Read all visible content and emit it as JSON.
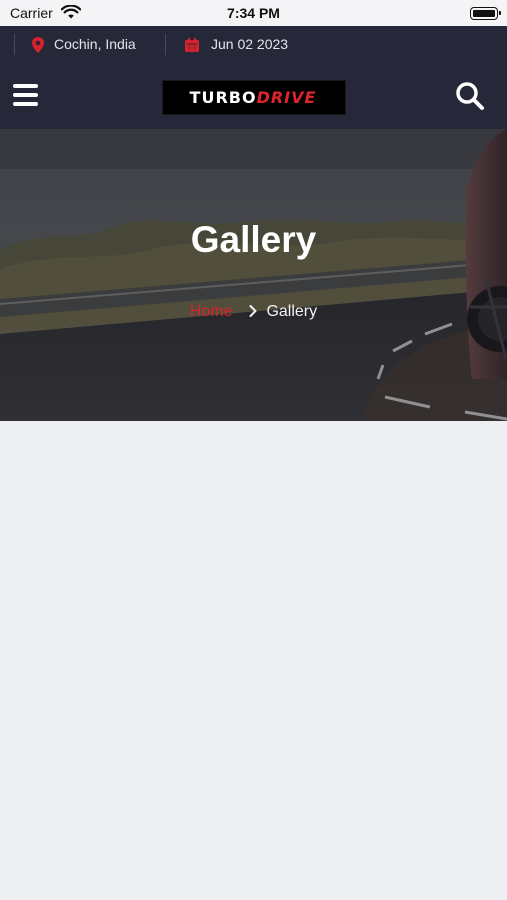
{
  "status_bar": {
    "carrier": "Carrier",
    "time": "7:34 PM"
  },
  "info_bar": {
    "location": "Cochin, India",
    "date": "Jun 02 2023"
  },
  "header": {
    "logo_text_part1": "TURBO",
    "logo_text_part2": "DRIVE"
  },
  "hero": {
    "title": "Gallery",
    "breadcrumb": {
      "home": "Home",
      "current": "Gallery"
    }
  },
  "colors": {
    "accent": "#d8232a",
    "header_bg": "#26283a",
    "page_bg": "#edeff3"
  }
}
